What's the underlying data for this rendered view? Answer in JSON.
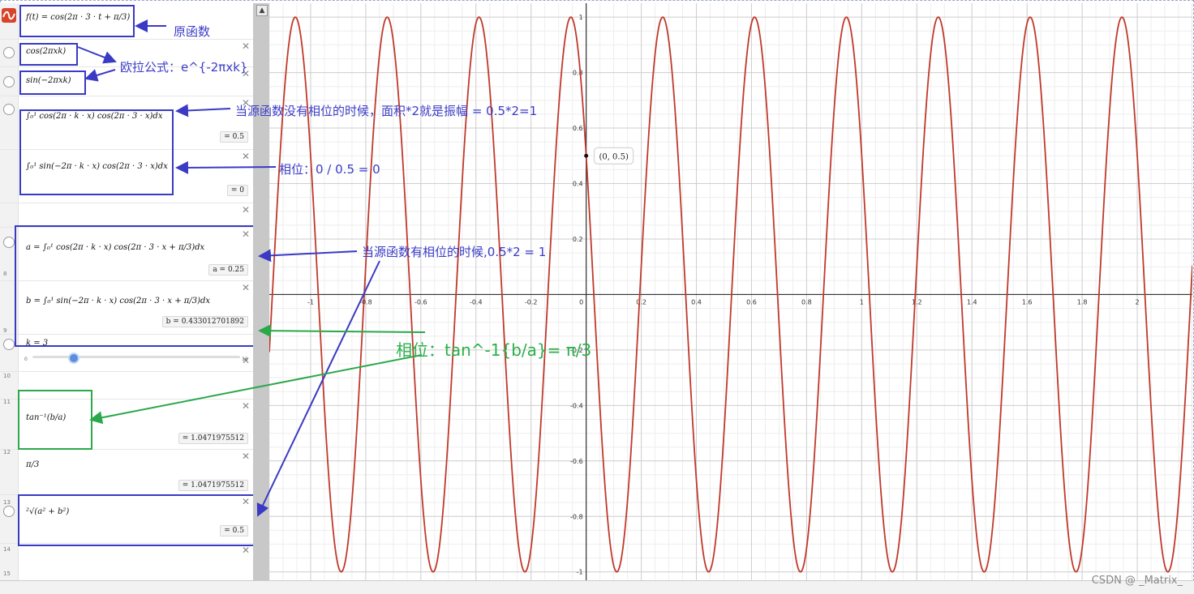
{
  "algebra": {
    "rows": [
      {
        "num": "",
        "expr": "f(t)  = cos(2π · 3 · t + π/3)",
        "result": ""
      },
      {
        "num": "",
        "expr": "cos(2πxk)",
        "result": ""
      },
      {
        "num": "",
        "expr": "sin(−2πxk)",
        "result": ""
      },
      {
        "num": "",
        "expr": "∫₀¹ cos(2π · k · x) cos(2π · 3 · x)dx",
        "result": "= 0.5"
      },
      {
        "num": "",
        "expr": "∫₀¹ sin(−2π · k · x) cos(2π · 3 · x)dx",
        "result": "= 0"
      },
      {
        "num": "",
        "expr": "a = ∫₀¹ cos(2π · k · x) cos(2π · 3 · x + π/3)dx",
        "result": "a = 0.25"
      },
      {
        "num": "",
        "expr": "b = ∫₀¹ sin(−2π · k · x) cos(2π · 3 · x + π/3)dx",
        "result": "b = 0.433012701892"
      },
      {
        "num": "",
        "expr": "k = 3",
        "result": ""
      },
      {
        "num": "",
        "expr": "tan⁻¹(b/a)",
        "result": "= 1.0471975512"
      },
      {
        "num": "",
        "expr": "π/3",
        "result": "= 1.0471975512"
      },
      {
        "num": "",
        "expr": "²√(a² + b²)",
        "result": "= 0.5"
      }
    ],
    "slider": {
      "min": "0",
      "max": "16"
    },
    "rownums": [
      "8",
      "9",
      "10",
      "11",
      "12",
      "13",
      "14",
      "15"
    ]
  },
  "annotations": {
    "original": "原函数",
    "euler": "欧拉公式：e^{-2πxk}",
    "no_phase": "当源函数没有相位的时候，面积*2就是振幅 = 0.5*2=1",
    "phase_zero": "相位：0  / 0.5 = 0",
    "with_phase": "当源函数有相位的时候,0.5*2 = 1",
    "phase_tan": "相位：tan^-1{b/a}= π/3"
  },
  "graph": {
    "point_label": "(0, 0.5)",
    "x_ticks": [
      "-1",
      "-0.8",
      "-0.6",
      "-0.4",
      "-0.2",
      "0",
      "0.2",
      "0.4",
      "0.6",
      "0.8",
      "1",
      "1.2",
      "1.4",
      "1.6",
      "1.8",
      "2"
    ],
    "y_ticks": [
      "1",
      "0.8",
      "0.6",
      "0.4",
      "0.2",
      "-0.2",
      "-0.4",
      "-0.6",
      "-0.8",
      "-1"
    ],
    "curve_color": "#c0392b",
    "x_range": [
      -1.15,
      2.2
    ],
    "y_range": [
      -1.03,
      1.05
    ],
    "frequency": 3,
    "phase": 1.0471975512
  },
  "watermark": "CSDN @ _Matrix_",
  "colors": {
    "blue": "#3a3ac4",
    "green": "#2aa84a"
  }
}
